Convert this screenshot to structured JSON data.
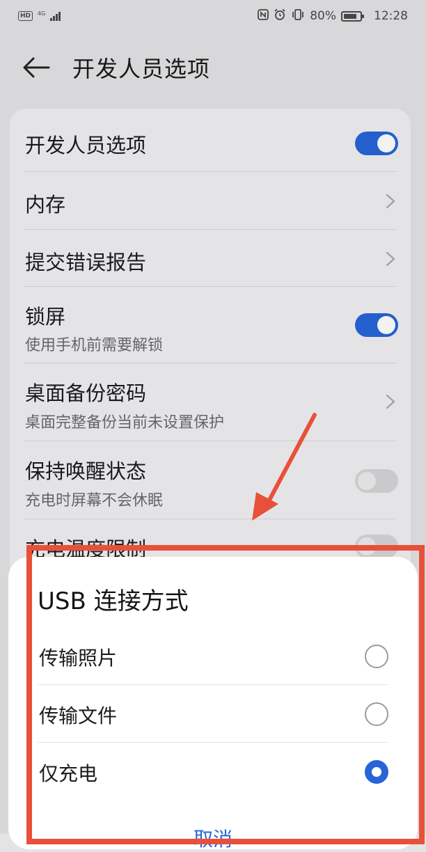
{
  "status_bar": {
    "hd_badge": "HD",
    "network": "4G",
    "nfc_icon": "nfc-icon",
    "alarm_icon": "alarm-icon",
    "vibrate_icon": "vibrate-icon",
    "battery_percent": "80%",
    "battery_level": 0.8,
    "time": "12:28"
  },
  "header": {
    "back_icon": "back-arrow-icon",
    "title": "开发人员选项"
  },
  "settings": {
    "items": [
      {
        "title": "开发人员选项",
        "control": "toggle",
        "state": "on"
      },
      {
        "title": "内存",
        "control": "chevron"
      },
      {
        "title": "提交错误报告",
        "control": "chevron"
      },
      {
        "title": "锁屏",
        "subtitle": "使用手机前需要解锁",
        "control": "toggle",
        "state": "on"
      },
      {
        "title": "桌面备份密码",
        "subtitle": "桌面完整备份当前未设置保护",
        "control": "chevron"
      },
      {
        "title": "保持唤醒状态",
        "subtitle": "充电时屏幕不会休眠",
        "control": "toggle",
        "state": "off"
      },
      {
        "title": "充电温度限制",
        "control": "toggle",
        "state": "off"
      }
    ]
  },
  "dialog": {
    "title": "USB 连接方式",
    "options": [
      {
        "label": "传输照片",
        "selected": false
      },
      {
        "label": "传输文件",
        "selected": false
      },
      {
        "label": "仅充电",
        "selected": true
      }
    ],
    "cancel_label": "取消"
  },
  "colors": {
    "accent": "#2764d8",
    "annotation_red": "#e8503a",
    "background": "#e4e4e6",
    "card": "#f1f1f3"
  }
}
